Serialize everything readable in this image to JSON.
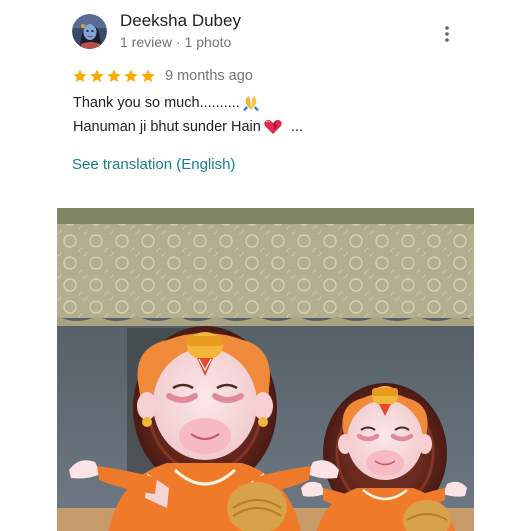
{
  "reviewer": {
    "name": "Deeksha Dubey",
    "meta": "1 review · 1 photo",
    "avatar_icon": "avatar-image"
  },
  "rating": {
    "stars": 5,
    "max_stars": 5,
    "date": "9 months ago",
    "star_color": "#f9ab00"
  },
  "review": {
    "line1": "Thank you so much..........",
    "line1_emoji": "folded-hands-icon",
    "line2": "Hanuman ji bhut sunder Hain",
    "line2_emoji": "heart-icon",
    "more": "..."
  },
  "actions": {
    "see_translation": "See translation (English)",
    "more_icon": "more-vert-icon"
  },
  "colors": {
    "name": "#202124",
    "meta": "#70757a",
    "link": "#177c8b"
  }
}
